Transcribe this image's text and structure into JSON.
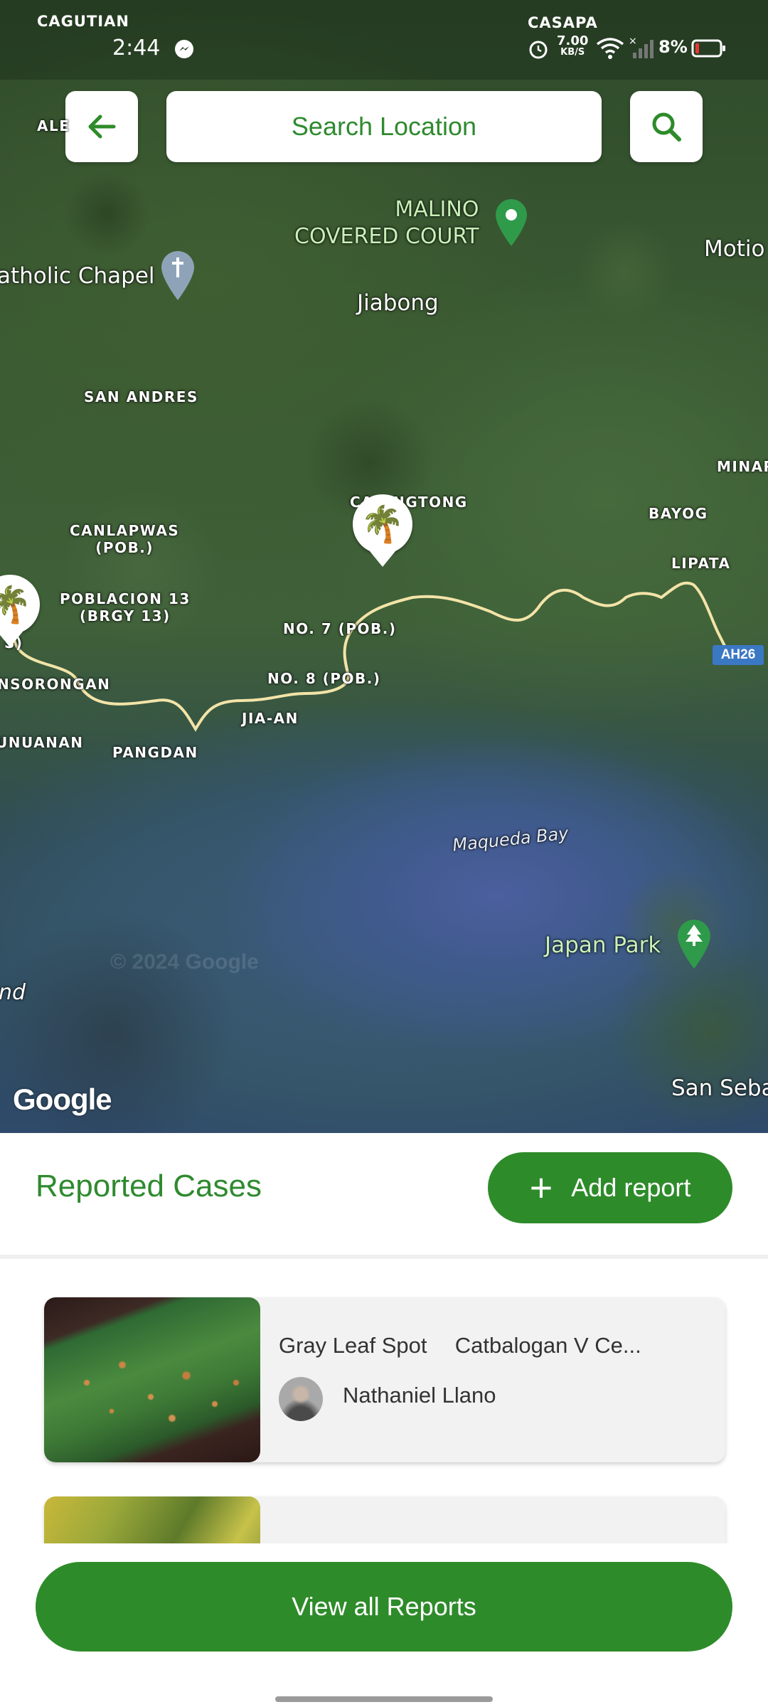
{
  "status_bar": {
    "carrier_left": "CAGUTIAN",
    "time": "2:44",
    "carrier_right": "CASAPA",
    "net_speed_value": "7.00",
    "net_speed_unit": "KB/S",
    "battery": "8%",
    "icons": [
      "messenger-icon",
      "alarm-icon",
      "wifi-icon",
      "signal-icon",
      "battery-icon"
    ]
  },
  "toolbar": {
    "back_icon": "arrow-left-icon",
    "search_placeholder": "Search Location",
    "search_icon": "search-icon"
  },
  "map": {
    "labels": {
      "ale": "ALE",
      "malino": "MALINO\nCOVERED COURT",
      "chapel": "atholic Chapel",
      "motio": "Motio",
      "jiabong": "Jiabong",
      "san_andres": "SAN ANDRES",
      "minar": "MINAR",
      "canlapwas": "CANLAPWAS\n(POB.)",
      "ca_ongtong": "CA   ONGTONG",
      "bayog": "BAYOG",
      "lipata": "LIPATA",
      "poblacion13": "POBLACION 13\n(BRGY 13)",
      "no7": "NO. 7 (POB.)",
      "s_frag": "S)",
      "nsorongan": "NSORONGAN",
      "no8": "NO. 8 (POB.)",
      "jia_an": "JIA-AN",
      "unuanan": "UNUANAN",
      "pangdan": "PANGDAN",
      "maqueda_bay": "Maqueda Bay",
      "japan_park": "Japan Park",
      "nd": "nd",
      "san_seba": "San Seba",
      "route_shield": "AH26",
      "google_logo": "Google",
      "watermark": "© 2024 Google"
    },
    "markers": [
      "palm-tree-marker",
      "palm-tree-marker"
    ]
  },
  "reports": {
    "section_title": "Reported Cases",
    "add_button_label": "Add report",
    "items": [
      {
        "disease": "Gray Leaf Spot",
        "location": "Catbalogan V Ce...",
        "reporter": "Nathaniel Llano"
      },
      {
        "disease": "",
        "location": "",
        "reporter": ""
      }
    ],
    "view_all_label": "View all Reports"
  },
  "colors": {
    "brand_green": "#2e8b2a",
    "text_green": "#2f8a2f",
    "card_bg": "#f2f2f2"
  }
}
